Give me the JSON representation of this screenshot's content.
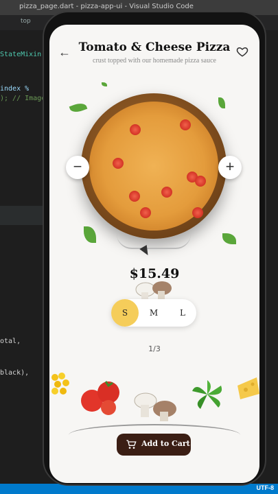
{
  "ide": {
    "window_title": "pizza_page.dart - pizza-app-ui - Visual Studio Code",
    "tab_label": "top",
    "code_lines": [
      {
        "text": "StateMixin",
        "color": "#4ec9b0"
      },
      {
        "text": "index %",
        "color": "#9cdcfe"
      },
      {
        "text": "); // Image",
        "color": "#6a9955"
      },
      {
        "text": "otal,",
        "color": "#d4d4d4"
      },
      {
        "text": "black),",
        "color": "#d4d4d4"
      }
    ],
    "status_encoding": "UTF-8"
  },
  "app": {
    "title": "Tomato & Cheese Pizza",
    "subtitle": "crust topped with our homemade pizza sauce",
    "price": "$15.49",
    "sizes": [
      "S",
      "M",
      "L"
    ],
    "selected_size": "S",
    "pager": "1/3",
    "add_to_cart_label": "Add to Cart",
    "icons": {
      "back": "back-arrow-icon",
      "favorite": "heart-outline-icon",
      "minus": "minus-icon",
      "plus": "plus-icon",
      "cart": "cart-icon"
    },
    "ingredients": [
      "corn",
      "tomato",
      "mushroom",
      "basil",
      "cheese"
    ],
    "colors": {
      "selected_size_bg": "#f5cd5a",
      "cart_button_bg": "#3b1e14",
      "screen_bg": "#f7f6f4"
    }
  }
}
